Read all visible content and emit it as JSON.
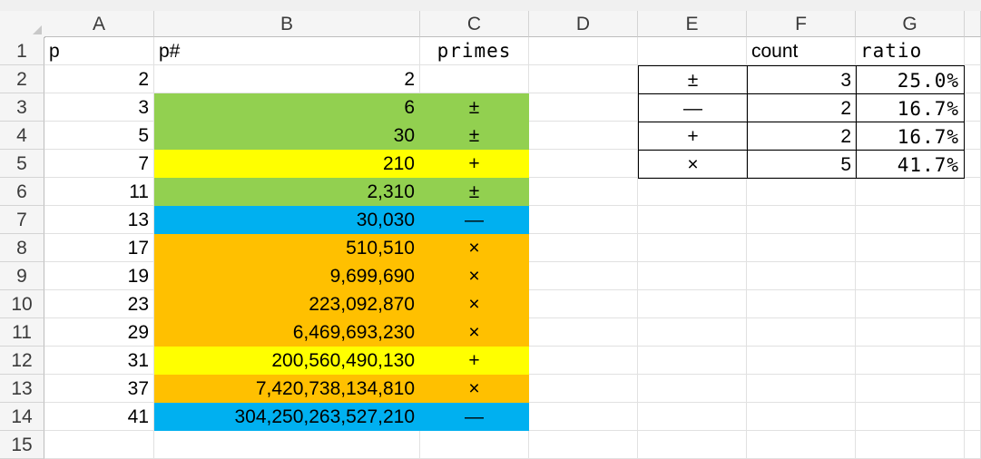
{
  "columns": [
    "A",
    "B",
    "C",
    "D",
    "E",
    "F",
    "G"
  ],
  "rows": [
    "1",
    "2",
    "3",
    "4",
    "5",
    "6",
    "7",
    "8",
    "9",
    "10",
    "11",
    "12",
    "13",
    "14",
    "15"
  ],
  "headers": {
    "a": "p",
    "b": "p#",
    "c": "primes",
    "f": "count",
    "g": "ratio"
  },
  "data": [
    {
      "p": "2",
      "primorial": "2",
      "prime": "",
      "color": ""
    },
    {
      "p": "3",
      "primorial": "6",
      "prime": "±",
      "color": "#92d050"
    },
    {
      "p": "5",
      "primorial": "30",
      "prime": "±",
      "color": "#92d050"
    },
    {
      "p": "7",
      "primorial": "210",
      "prime": "+",
      "color": "#ffff00"
    },
    {
      "p": "11",
      "primorial": "2,310",
      "prime": "±",
      "color": "#92d050"
    },
    {
      "p": "13",
      "primorial": "30,030",
      "prime": "—",
      "color": "#00b0f0"
    },
    {
      "p": "17",
      "primorial": "510,510",
      "prime": "×",
      "color": "#ffc000"
    },
    {
      "p": "19",
      "primorial": "9,699,690",
      "prime": "×",
      "color": "#ffc000"
    },
    {
      "p": "23",
      "primorial": "223,092,870",
      "prime": "×",
      "color": "#ffc000"
    },
    {
      "p": "29",
      "primorial": "6,469,693,230",
      "prime": "×",
      "color": "#ffc000"
    },
    {
      "p": "31",
      "primorial": "200,560,490,130",
      "prime": "+",
      "color": "#ffff00"
    },
    {
      "p": "37",
      "primorial": "7,420,738,134,810",
      "prime": "×",
      "color": "#ffc000"
    },
    {
      "p": "41",
      "primorial": "304,250,263,527,210",
      "prime": "—",
      "color": "#00b0f0"
    }
  ],
  "summary": [
    {
      "symbol": "±",
      "count": "3",
      "ratio": "25.0%"
    },
    {
      "symbol": "—",
      "count": "2",
      "ratio": "16.7%"
    },
    {
      "symbol": "+",
      "count": "2",
      "ratio": "16.7%"
    },
    {
      "symbol": "×",
      "count": "5",
      "ratio": "41.7%"
    }
  ]
}
